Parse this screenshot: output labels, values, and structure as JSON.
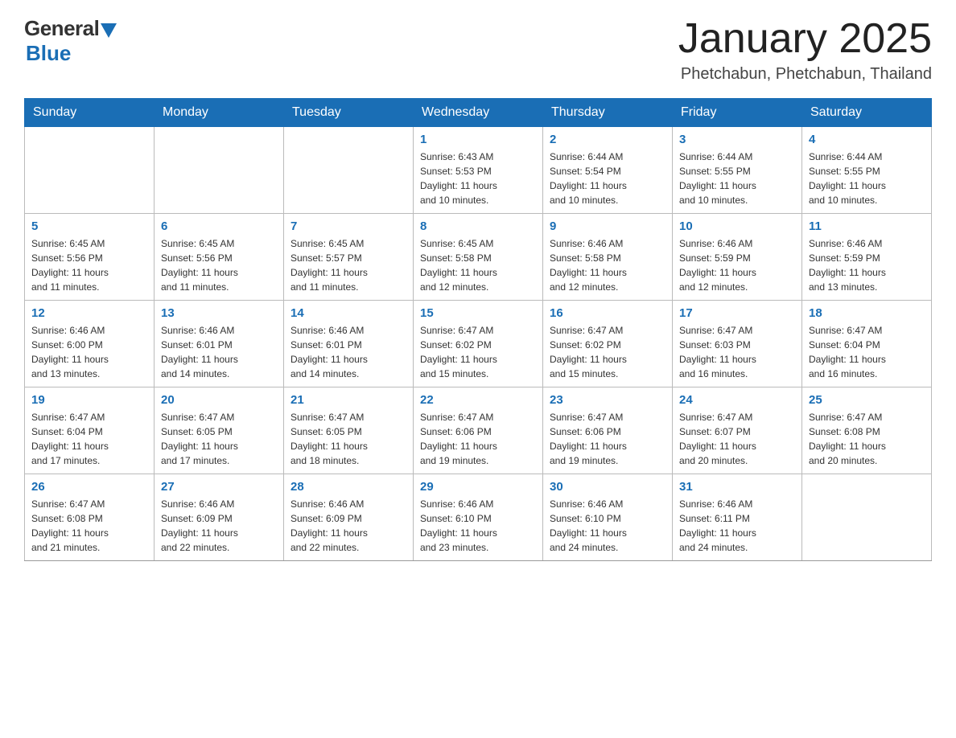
{
  "logo": {
    "general": "General",
    "blue": "Blue"
  },
  "title": "January 2025",
  "location": "Phetchabun, Phetchabun, Thailand",
  "headers": [
    "Sunday",
    "Monday",
    "Tuesday",
    "Wednesday",
    "Thursday",
    "Friday",
    "Saturday"
  ],
  "weeks": [
    [
      {
        "day": "",
        "info": ""
      },
      {
        "day": "",
        "info": ""
      },
      {
        "day": "",
        "info": ""
      },
      {
        "day": "1",
        "info": "Sunrise: 6:43 AM\nSunset: 5:53 PM\nDaylight: 11 hours\nand 10 minutes."
      },
      {
        "day": "2",
        "info": "Sunrise: 6:44 AM\nSunset: 5:54 PM\nDaylight: 11 hours\nand 10 minutes."
      },
      {
        "day": "3",
        "info": "Sunrise: 6:44 AM\nSunset: 5:55 PM\nDaylight: 11 hours\nand 10 minutes."
      },
      {
        "day": "4",
        "info": "Sunrise: 6:44 AM\nSunset: 5:55 PM\nDaylight: 11 hours\nand 10 minutes."
      }
    ],
    [
      {
        "day": "5",
        "info": "Sunrise: 6:45 AM\nSunset: 5:56 PM\nDaylight: 11 hours\nand 11 minutes."
      },
      {
        "day": "6",
        "info": "Sunrise: 6:45 AM\nSunset: 5:56 PM\nDaylight: 11 hours\nand 11 minutes."
      },
      {
        "day": "7",
        "info": "Sunrise: 6:45 AM\nSunset: 5:57 PM\nDaylight: 11 hours\nand 11 minutes."
      },
      {
        "day": "8",
        "info": "Sunrise: 6:45 AM\nSunset: 5:58 PM\nDaylight: 11 hours\nand 12 minutes."
      },
      {
        "day": "9",
        "info": "Sunrise: 6:46 AM\nSunset: 5:58 PM\nDaylight: 11 hours\nand 12 minutes."
      },
      {
        "day": "10",
        "info": "Sunrise: 6:46 AM\nSunset: 5:59 PM\nDaylight: 11 hours\nand 12 minutes."
      },
      {
        "day": "11",
        "info": "Sunrise: 6:46 AM\nSunset: 5:59 PM\nDaylight: 11 hours\nand 13 minutes."
      }
    ],
    [
      {
        "day": "12",
        "info": "Sunrise: 6:46 AM\nSunset: 6:00 PM\nDaylight: 11 hours\nand 13 minutes."
      },
      {
        "day": "13",
        "info": "Sunrise: 6:46 AM\nSunset: 6:01 PM\nDaylight: 11 hours\nand 14 minutes."
      },
      {
        "day": "14",
        "info": "Sunrise: 6:46 AM\nSunset: 6:01 PM\nDaylight: 11 hours\nand 14 minutes."
      },
      {
        "day": "15",
        "info": "Sunrise: 6:47 AM\nSunset: 6:02 PM\nDaylight: 11 hours\nand 15 minutes."
      },
      {
        "day": "16",
        "info": "Sunrise: 6:47 AM\nSunset: 6:02 PM\nDaylight: 11 hours\nand 15 minutes."
      },
      {
        "day": "17",
        "info": "Sunrise: 6:47 AM\nSunset: 6:03 PM\nDaylight: 11 hours\nand 16 minutes."
      },
      {
        "day": "18",
        "info": "Sunrise: 6:47 AM\nSunset: 6:04 PM\nDaylight: 11 hours\nand 16 minutes."
      }
    ],
    [
      {
        "day": "19",
        "info": "Sunrise: 6:47 AM\nSunset: 6:04 PM\nDaylight: 11 hours\nand 17 minutes."
      },
      {
        "day": "20",
        "info": "Sunrise: 6:47 AM\nSunset: 6:05 PM\nDaylight: 11 hours\nand 17 minutes."
      },
      {
        "day": "21",
        "info": "Sunrise: 6:47 AM\nSunset: 6:05 PM\nDaylight: 11 hours\nand 18 minutes."
      },
      {
        "day": "22",
        "info": "Sunrise: 6:47 AM\nSunset: 6:06 PM\nDaylight: 11 hours\nand 19 minutes."
      },
      {
        "day": "23",
        "info": "Sunrise: 6:47 AM\nSunset: 6:06 PM\nDaylight: 11 hours\nand 19 minutes."
      },
      {
        "day": "24",
        "info": "Sunrise: 6:47 AM\nSunset: 6:07 PM\nDaylight: 11 hours\nand 20 minutes."
      },
      {
        "day": "25",
        "info": "Sunrise: 6:47 AM\nSunset: 6:08 PM\nDaylight: 11 hours\nand 20 minutes."
      }
    ],
    [
      {
        "day": "26",
        "info": "Sunrise: 6:47 AM\nSunset: 6:08 PM\nDaylight: 11 hours\nand 21 minutes."
      },
      {
        "day": "27",
        "info": "Sunrise: 6:46 AM\nSunset: 6:09 PM\nDaylight: 11 hours\nand 22 minutes."
      },
      {
        "day": "28",
        "info": "Sunrise: 6:46 AM\nSunset: 6:09 PM\nDaylight: 11 hours\nand 22 minutes."
      },
      {
        "day": "29",
        "info": "Sunrise: 6:46 AM\nSunset: 6:10 PM\nDaylight: 11 hours\nand 23 minutes."
      },
      {
        "day": "30",
        "info": "Sunrise: 6:46 AM\nSunset: 6:10 PM\nDaylight: 11 hours\nand 24 minutes."
      },
      {
        "day": "31",
        "info": "Sunrise: 6:46 AM\nSunset: 6:11 PM\nDaylight: 11 hours\nand 24 minutes."
      },
      {
        "day": "",
        "info": ""
      }
    ]
  ]
}
